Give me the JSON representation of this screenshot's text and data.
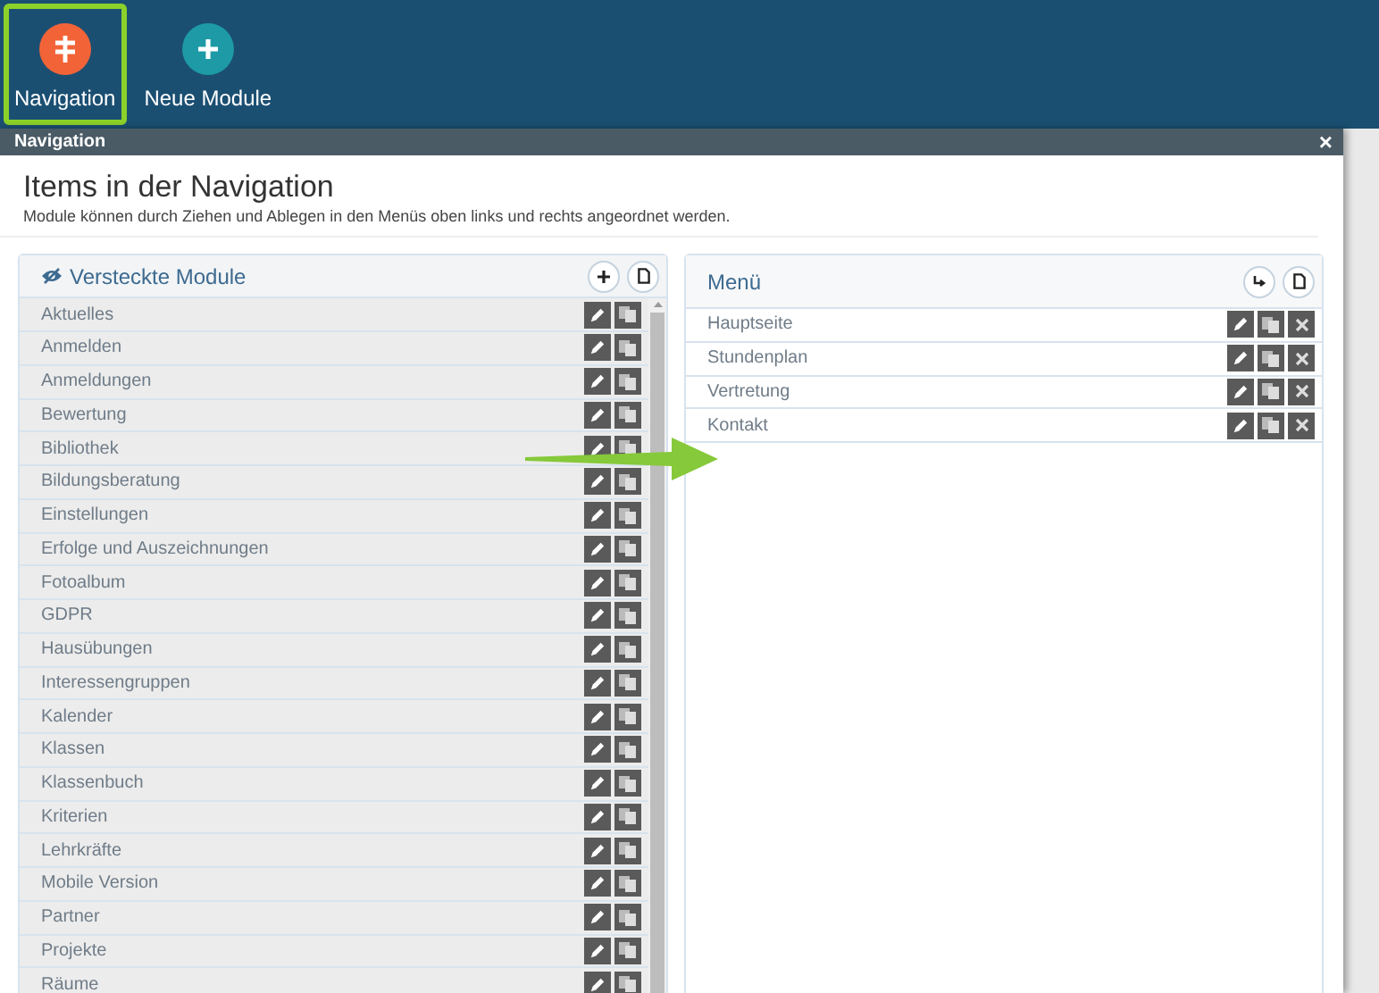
{
  "toolbar": [
    {
      "label": "Navigation",
      "kind": "navigation",
      "selected": true
    },
    {
      "label": "Neue Module",
      "kind": "add",
      "selected": false
    }
  ],
  "dialog": {
    "title": "Navigation",
    "close": "×",
    "heading": "Items in der Navigation",
    "description": "Module können durch Ziehen und Ablegen in den Menüs oben links und rechts angeordnet werden."
  },
  "hidden_modules": {
    "title": "Versteckte Module",
    "items": [
      {
        "label": "Aktuelles"
      },
      {
        "label": "Anmelden"
      },
      {
        "label": "Anmeldungen"
      },
      {
        "label": "Bewertung"
      },
      {
        "label": "Bibliothek"
      },
      {
        "label": "Bildungsberatung"
      },
      {
        "label": "Einstellungen"
      },
      {
        "label": "Erfolge und Auszeichnungen"
      },
      {
        "label": "Fotoalbum"
      },
      {
        "label": "GDPR"
      },
      {
        "label": "Hausübungen"
      },
      {
        "label": "Interessengruppen"
      },
      {
        "label": "Kalender"
      },
      {
        "label": "Klassen"
      },
      {
        "label": "Klassenbuch"
      },
      {
        "label": "Kriterien"
      },
      {
        "label": "Lehrkräfte"
      },
      {
        "label": "Mobile Version"
      },
      {
        "label": "Partner"
      },
      {
        "label": "Projekte"
      },
      {
        "label": "Räume"
      }
    ]
  },
  "menu": {
    "title": "Menü",
    "items": [
      {
        "label": "Hauptseite"
      },
      {
        "label": "Stundenplan"
      },
      {
        "label": "Vertretung"
      },
      {
        "label": "Kontakt"
      }
    ]
  }
}
